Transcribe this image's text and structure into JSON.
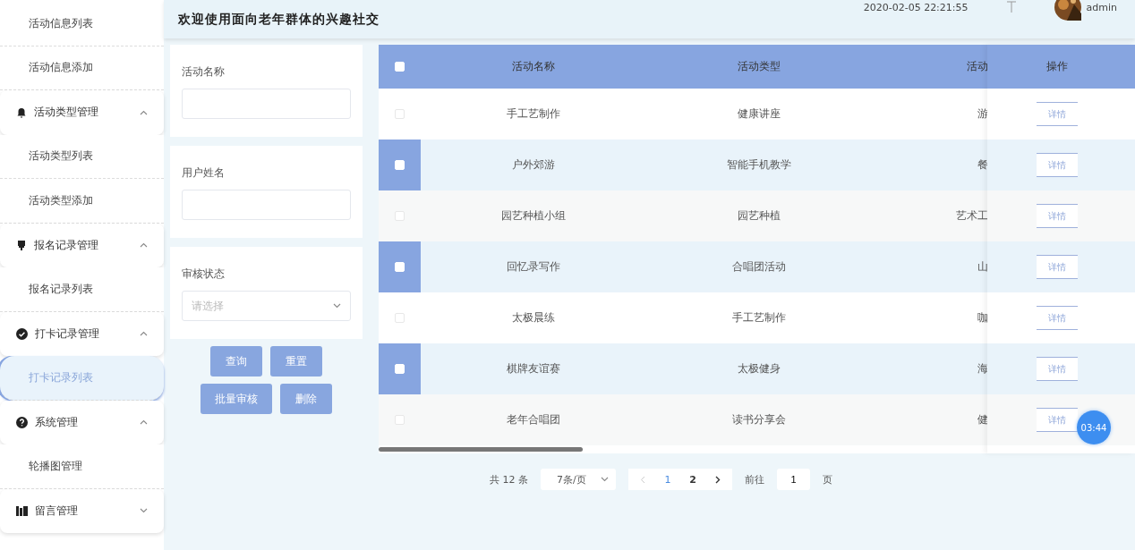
{
  "sidebar": {
    "items": [
      {
        "kind": "sub",
        "label": "活动信息列表",
        "selected": false
      },
      {
        "kind": "sub",
        "label": "活动信息添加",
        "selected": false
      },
      {
        "kind": "group",
        "label": "活动类型管理",
        "expanded": true
      },
      {
        "kind": "sub",
        "label": "活动类型列表",
        "selected": false
      },
      {
        "kind": "sub",
        "label": "活动类型添加",
        "selected": false
      },
      {
        "kind": "group",
        "label": "报名记录管理",
        "expanded": true
      },
      {
        "kind": "sub",
        "label": "报名记录列表",
        "selected": false
      },
      {
        "kind": "group",
        "label": "打卡记录管理",
        "expanded": true
      },
      {
        "kind": "sub",
        "label": "打卡记录列表",
        "selected": true
      },
      {
        "kind": "group",
        "label": "系统管理",
        "expanded": true
      },
      {
        "kind": "sub",
        "label": "轮播图管理",
        "selected": false
      },
      {
        "kind": "group",
        "label": "留言管理",
        "expanded": false
      }
    ]
  },
  "header": {
    "title": "欢迎使用面向老年群体的兴趣社交",
    "datetime": "2020-02-05 22:21:55",
    "user": "admin"
  },
  "search": {
    "fields": [
      {
        "kind": "text",
        "label": "活动名称"
      },
      {
        "kind": "text",
        "label": "用户姓名"
      },
      {
        "kind": "select",
        "label": "审核状态",
        "placeholder": "请选择"
      }
    ],
    "buttons": [
      [
        "查询",
        "重置"
      ],
      [
        "批量审核",
        "删除"
      ]
    ]
  },
  "table": {
    "select_all_checked": false,
    "columns": [
      "活动名称",
      "活动类型",
      "活动",
      "操作"
    ],
    "rows": [
      {
        "selected": false,
        "cells": [
          "手工艺制作",
          "健康讲座",
          "游"
        ],
        "action": "详情"
      },
      {
        "selected": true,
        "cells": [
          "户外郊游",
          "智能手机教学",
          "餐"
        ],
        "action": "详情"
      },
      {
        "selected": false,
        "cells": [
          "园艺种植小组",
          "园艺种植",
          "艺术工"
        ],
        "action": "详情"
      },
      {
        "selected": true,
        "cells": [
          "回忆录写作",
          "合唱团活动",
          "山"
        ],
        "action": "详情"
      },
      {
        "selected": false,
        "cells": [
          "太极晨练",
          "手工艺制作",
          "咖"
        ],
        "action": "详情"
      },
      {
        "selected": true,
        "cells": [
          "棋牌友谊赛",
          "太极健身",
          "海"
        ],
        "action": "详情"
      },
      {
        "selected": false,
        "cells": [
          "老年合唱团",
          "读书分享会",
          "健"
        ],
        "action": "详情"
      }
    ]
  },
  "pagination": {
    "total": "共 12 条",
    "page_size": "7条/页",
    "pages": [
      {
        "label": "1",
        "selected": true
      },
      {
        "label": "2",
        "selected": false
      }
    ],
    "goto_label": "前往",
    "goto_value": "1",
    "goto_suffix": "页"
  },
  "timer": "03:44"
}
